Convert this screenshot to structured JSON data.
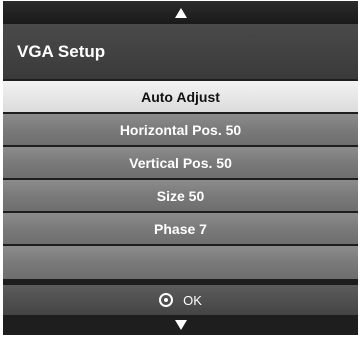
{
  "title": "VGA Setup",
  "menu": {
    "items": [
      {
        "label": "Auto Adjust",
        "selected": true
      },
      {
        "label": "Horizontal Pos. 50",
        "selected": false
      },
      {
        "label": "Vertical Pos. 50",
        "selected": false
      },
      {
        "label": "Size 50",
        "selected": false
      },
      {
        "label": "Phase 7",
        "selected": false
      },
      {
        "label": "",
        "selected": false
      }
    ]
  },
  "footer": {
    "ok_label": "OK",
    "ok_icon": "ok-circle-icon"
  },
  "icons": {
    "scroll_up": "up-arrow-icon",
    "scroll_down": "down-arrow-icon"
  },
  "colors": {
    "selected_bg": "#e8e8e8",
    "item_bg": "#7a7a7a",
    "title_bg": "#404040",
    "frame_bg": "#1e1e1e"
  }
}
